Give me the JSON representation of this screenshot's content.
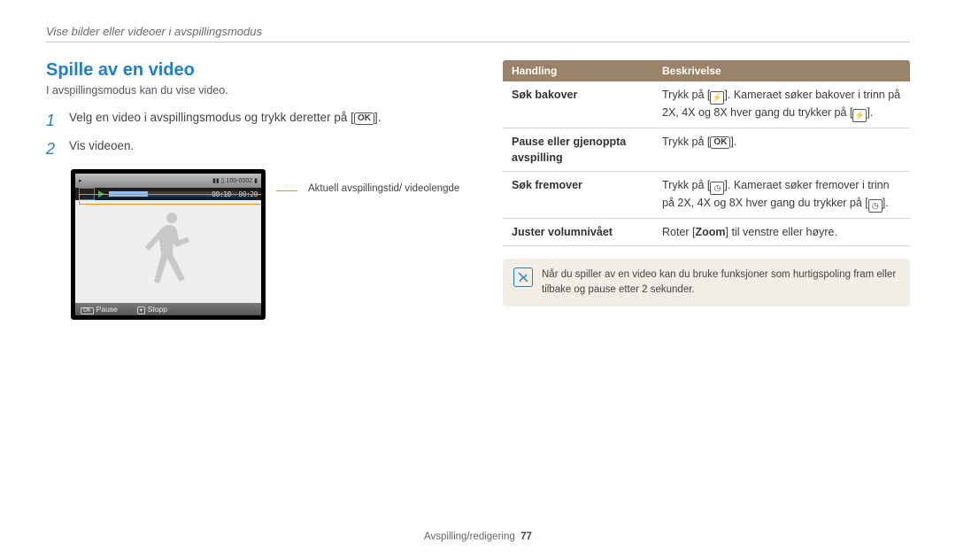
{
  "breadcrumb": "Vise bilder eller videoer i avspillingsmodus",
  "heading": "Spille av en video",
  "intro": "I avspillingsmodus kan du vise video.",
  "steps": {
    "s1_pre": "Velg en video i avspillingsmodus og trykk deretter på [",
    "s1_post": "].",
    "s2": "Vis videoen."
  },
  "ok_label": "OK",
  "figure": {
    "time_left": "00:10",
    "time_right": "00:20",
    "top_right": "100-0002",
    "pause": "Pause",
    "stopp": "Stopp",
    "caption": "Aktuell avspillingstid/ videolengde"
  },
  "table": {
    "h1": "Handling",
    "h2": "Beskrivelse",
    "r1a": "Søk bakover",
    "r1b_pre": "Trykk på [",
    "r1b_mid": "]. Kameraet søker bakover i trinn på 2X, 4X og 8X hver gang du trykker på [",
    "r1b_post": "].",
    "r2a": "Pause eller gjenoppta avspilling",
    "r2b_pre": "Trykk på [",
    "r2b_post": "].",
    "r3a": "Søk fremover",
    "r3b_pre": "Trykk på [",
    "r3b_mid": "]. Kameraet søker fremover i trinn på 2X, 4X og 8X hver gang du trykker på [",
    "r3b_post": "].",
    "r4a": "Juster volumnivået",
    "r4b_pre": "Roter [",
    "r4b_mid": "Zoom",
    "r4b_post": "] til venstre eller høyre."
  },
  "note": "Når du spiller av en video kan du bruke funksjoner som hurtigspoling fram eller tilbake og pause etter 2 sekunder.",
  "footer_label": "Avspilling/redigering",
  "page_no": "77"
}
